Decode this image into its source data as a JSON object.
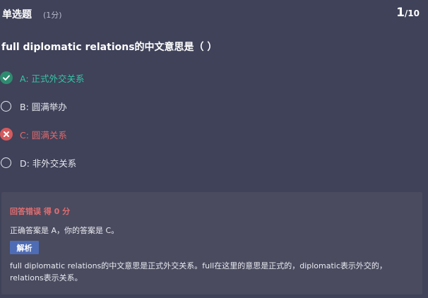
{
  "header": {
    "question_type": "单选题",
    "score": "(1分)",
    "current": "1",
    "separator": "/",
    "total": "10"
  },
  "question": {
    "text": "full diplomatic relations的中文意思是（  ）"
  },
  "options": [
    {
      "text": "A: 正式外交关系",
      "status": "correct",
      "icon": "check-circle-icon"
    },
    {
      "text": "B: 圆满举办",
      "status": "unselected",
      "icon": "radio-empty-icon"
    },
    {
      "text": "C: 圆满关系",
      "status": "wrong",
      "icon": "x-circle-icon"
    },
    {
      "text": "D: 非外交关系",
      "status": "unselected",
      "icon": "radio-empty-icon"
    }
  ],
  "result": {
    "title": "回答错误 得 0 分",
    "answer_line": "正确答案是 A，你的答案是 C。",
    "analysis_label": "解析",
    "analysis_text": "full diplomatic relations的中文意思是正式外交关系。full在这里的意思是正式的，diplomatic表示外交的，relations表示关系。"
  },
  "colors": {
    "background": "#3f4259",
    "card": "#4a4b5f",
    "correct": "#35c7a7",
    "wrong": "#e06b6e",
    "button": "#4e6cb6"
  }
}
